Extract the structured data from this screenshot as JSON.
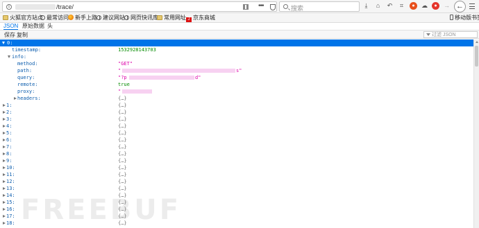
{
  "toolbar": {
    "url_path": "/trace/",
    "more_glyph": "•••",
    "search_placeholder": "搜索"
  },
  "bookmarks": {
    "items": [
      {
        "label": "火狐官方站点",
        "icon": "folder-icon"
      },
      {
        "label": "最常访问",
        "icon": "gear-icon"
      },
      {
        "label": "新手上路",
        "icon": "firefox-icon"
      },
      {
        "label": "建议网站",
        "icon": "globe-icon"
      },
      {
        "label": "网页快讯库",
        "icon": "globe-icon"
      },
      {
        "label": "常用网址",
        "icon": "folder-icon"
      },
      {
        "label": "京东商城",
        "icon": "jd-icon"
      }
    ],
    "mobile_label": "移动版书签"
  },
  "viewer": {
    "tabs": [
      "JSON",
      "原始数据",
      "头"
    ],
    "actions": [
      "保存",
      "复制"
    ],
    "filter_placeholder": "过滤 JSON"
  },
  "tree": {
    "root_key": "0:",
    "timestamp_key": "timestamp:",
    "timestamp_val": "1532928143703",
    "info_key": "info:",
    "method_key": "method:",
    "method_val": "\"GET\"",
    "path_key": "path:",
    "path_open": "\"",
    "path_close": "s\"",
    "query_key": "query:",
    "query_open": "\"?p",
    "query_close": "d\"",
    "remote_key": "remote:",
    "remote_val": "true",
    "proxy_key": "proxy:",
    "proxy_open": "\"",
    "headers_key": "headers:",
    "collapsed": "{…}",
    "items": [
      "1:",
      "2:",
      "3:",
      "4:",
      "5:",
      "6:",
      "7:",
      "8:",
      "9:",
      "10:",
      "11:",
      "12:",
      "13:",
      "14:",
      "15:",
      "16:",
      "17:",
      "18:"
    ]
  },
  "watermark": "FREEBUF",
  "colors": {
    "accent": "#0074e8",
    "number": "#058b00",
    "string": "#dd00a9",
    "key": "#0b5cad"
  }
}
